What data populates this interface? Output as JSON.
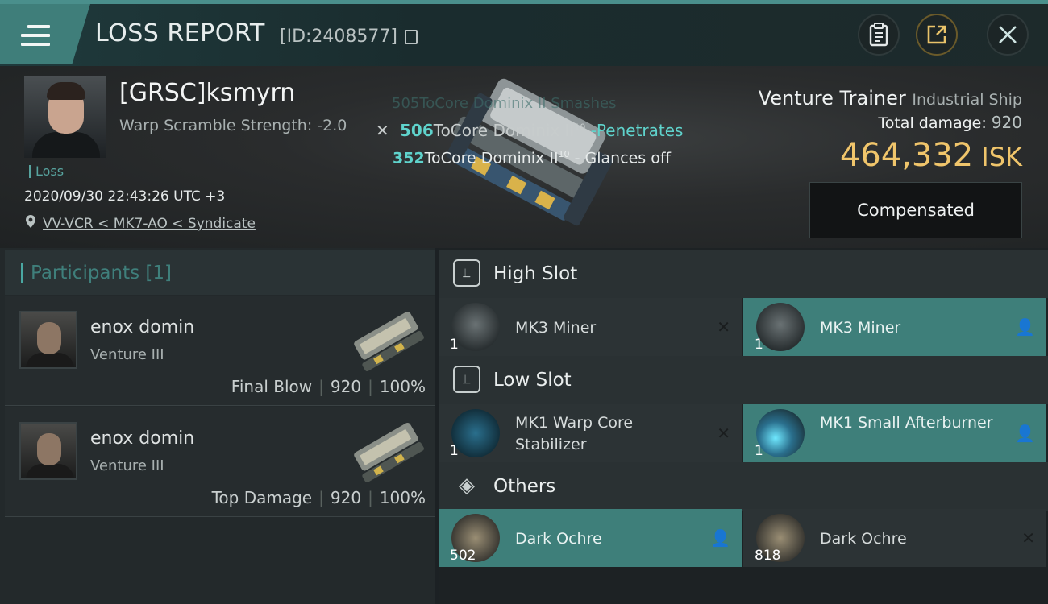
{
  "header": {
    "title": "LOSS REPORT",
    "report_id": "[ID:2408577]",
    "menu_icon": "hamburger-menu-icon",
    "clipboard_icon": "clipboard-icon",
    "share_icon": "share-icon",
    "close_icon": "close-icon"
  },
  "victim": {
    "name": "[GRSC]ksmyrn",
    "warp_scramble": "Warp Scramble Strength: -2.0",
    "status": "Loss",
    "datetime": "2020/09/30 22:43:26 UTC +3",
    "location": "VV-VCR < MK7-AO < Syndicate"
  },
  "damage_events": {
    "ghost": "505ToCore Dominix II Smashes",
    "row1_num": "506",
    "row1_text": "ToCore Dominix II",
    "row1_sup": "10",
    "row1_result": " -Penetrates",
    "row2_num": "352",
    "row2_text": "ToCore Dominix II",
    "row2_sup": "10",
    "row2_result": " - Glances off"
  },
  "ship": {
    "name": "Venture Trainer",
    "class": "Industrial Ship",
    "total_damage_label": "Total damage:",
    "total_damage_value": "920",
    "isk_value": "464,332",
    "isk_unit": "ISK",
    "compensated_label": "Compensated"
  },
  "participants": {
    "title": "Participants [1]",
    "rows": [
      {
        "name": "enox domin",
        "ship": "Venture III",
        "role": "Final Blow",
        "damage": "920",
        "percent": "100%"
      },
      {
        "name": "enox domin",
        "ship": "Venture III",
        "role": "Top Damage",
        "damage": "920",
        "percent": "100%"
      }
    ]
  },
  "fitting": {
    "high_slot_label": "High Slot",
    "low_slot_label": "Low Slot",
    "others_label": "Others",
    "high": [
      {
        "name": "MK3 Miner",
        "qty": "1",
        "state": "destroyed",
        "status_icon": "destroyed-x-icon"
      },
      {
        "name": "MK3 Miner",
        "qty": "1",
        "state": "dropped",
        "status_icon": "person-icon"
      }
    ],
    "low": [
      {
        "name": "MK1 Warp Core Stabilizer",
        "qty": "1",
        "state": "destroyed",
        "status_icon": "destroyed-x-icon"
      },
      {
        "name": "MK1 Small Afterburner",
        "qty": "1",
        "state": "dropped",
        "status_icon": "person-icon"
      }
    ],
    "others": [
      {
        "name": "Dark Ochre",
        "qty": "502",
        "state": "dropped",
        "status_icon": "person-icon"
      },
      {
        "name": "Dark Ochre",
        "qty": "818",
        "state": "destroyed",
        "status_icon": "destroyed-x-icon"
      }
    ]
  },
  "colors": {
    "accent": "#3e7f7a",
    "isk": "#f0c56b",
    "damage_highlight": "#5fd3cc"
  }
}
